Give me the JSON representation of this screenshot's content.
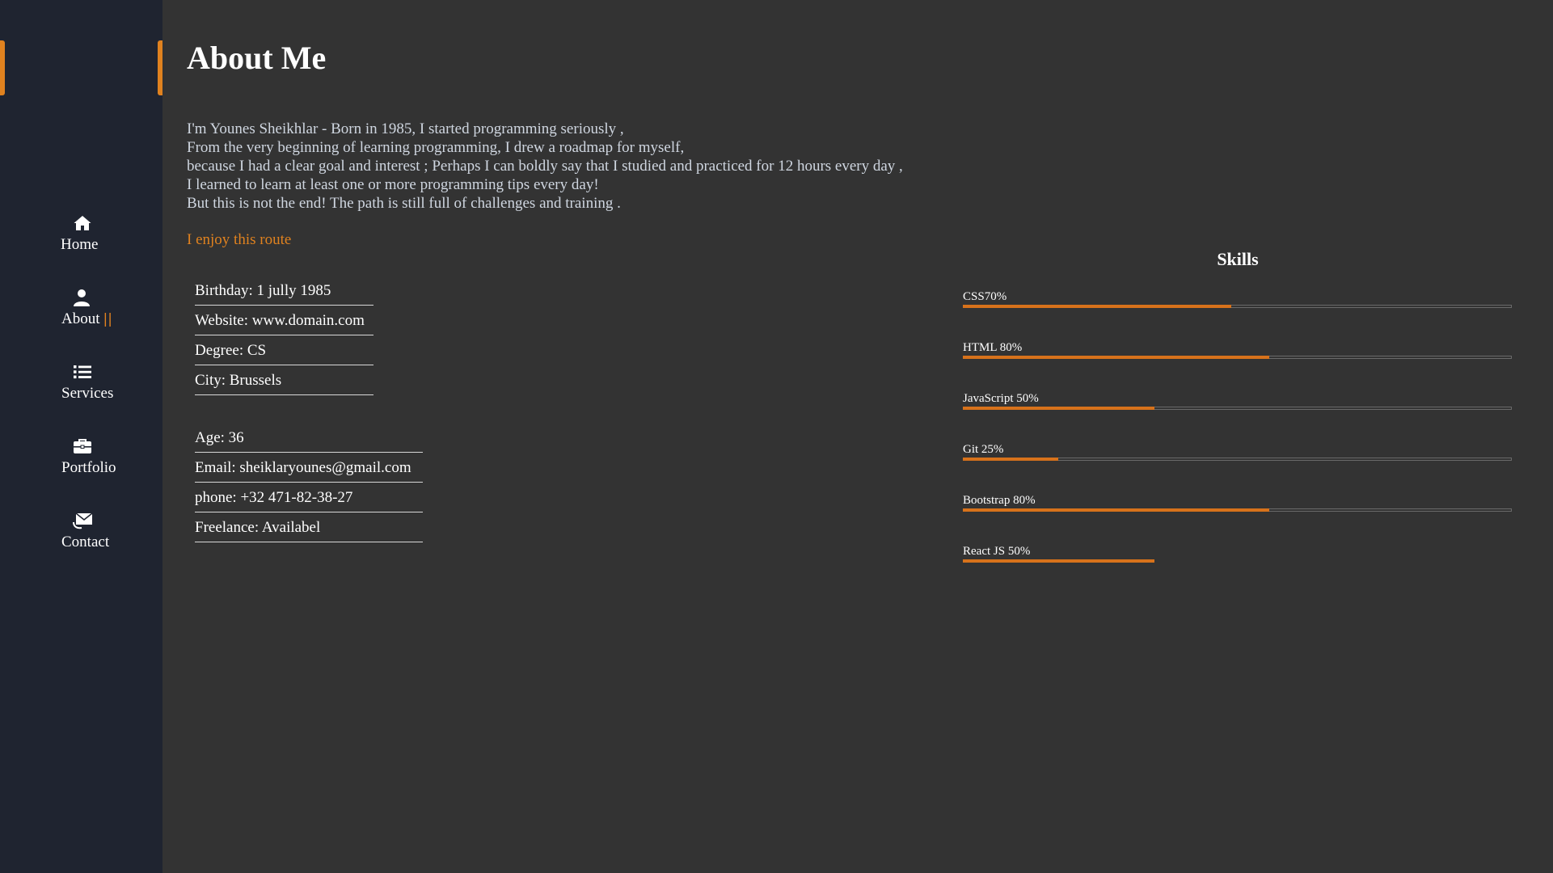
{
  "colors": {
    "accent": "#e0821f",
    "bar_fill": "#d7721b",
    "sidebar_bg": "#1f2430",
    "page_bg": "#333333"
  },
  "nav": {
    "items": [
      {
        "label": "Home",
        "icon": "home-icon",
        "active": false
      },
      {
        "label": "About",
        "icon": "user-icon",
        "active": true,
        "active_marker": "||"
      },
      {
        "label": "Services",
        "icon": "list-icon",
        "active": false
      },
      {
        "label": "Portfolio",
        "icon": "briefcase-icon",
        "active": false
      },
      {
        "label": "Contact",
        "icon": "mail-icon",
        "active": false
      }
    ]
  },
  "about": {
    "title": "About Me",
    "bio": [
      "I'm Younes Sheikhlar - Born in 1985, I started programming seriously ,",
      "From the very beginning of learning programming, I drew a roadmap for myself,",
      "because I had a clear goal and interest ; Perhaps I can boldly say that I studied and practiced for 12 hours every day ,",
      "I learned to learn at least one or more programming tips every day!",
      "But this is not the end! The path is still full of challenges and training ."
    ],
    "highlight": "I enjoy this route",
    "info_left": [
      "Birthday: 1 jully 1985",
      "Website: www.domain.com",
      "Degree: CS",
      "City: Brussels"
    ],
    "info_right": [
      "Age: 36",
      "Email: sheiklaryounes@gmail.com",
      "phone: +32 471-82-38-27",
      "Freelance: Availabel"
    ]
  },
  "skills": {
    "title": "Skills",
    "items": [
      {
        "label": "CSS70%",
        "value": 0.49,
        "track": true
      },
      {
        "label": "HTML 80%",
        "value": 0.56,
        "track": true
      },
      {
        "label": "JavaScript 50%",
        "value": 0.35,
        "track": true
      },
      {
        "label": "Git 25%",
        "value": 0.175,
        "track": true
      },
      {
        "label": "Bootstrap 80%",
        "value": 0.56,
        "track": true
      },
      {
        "label": "React JS 50%",
        "value": 0.35,
        "track": false
      }
    ]
  }
}
